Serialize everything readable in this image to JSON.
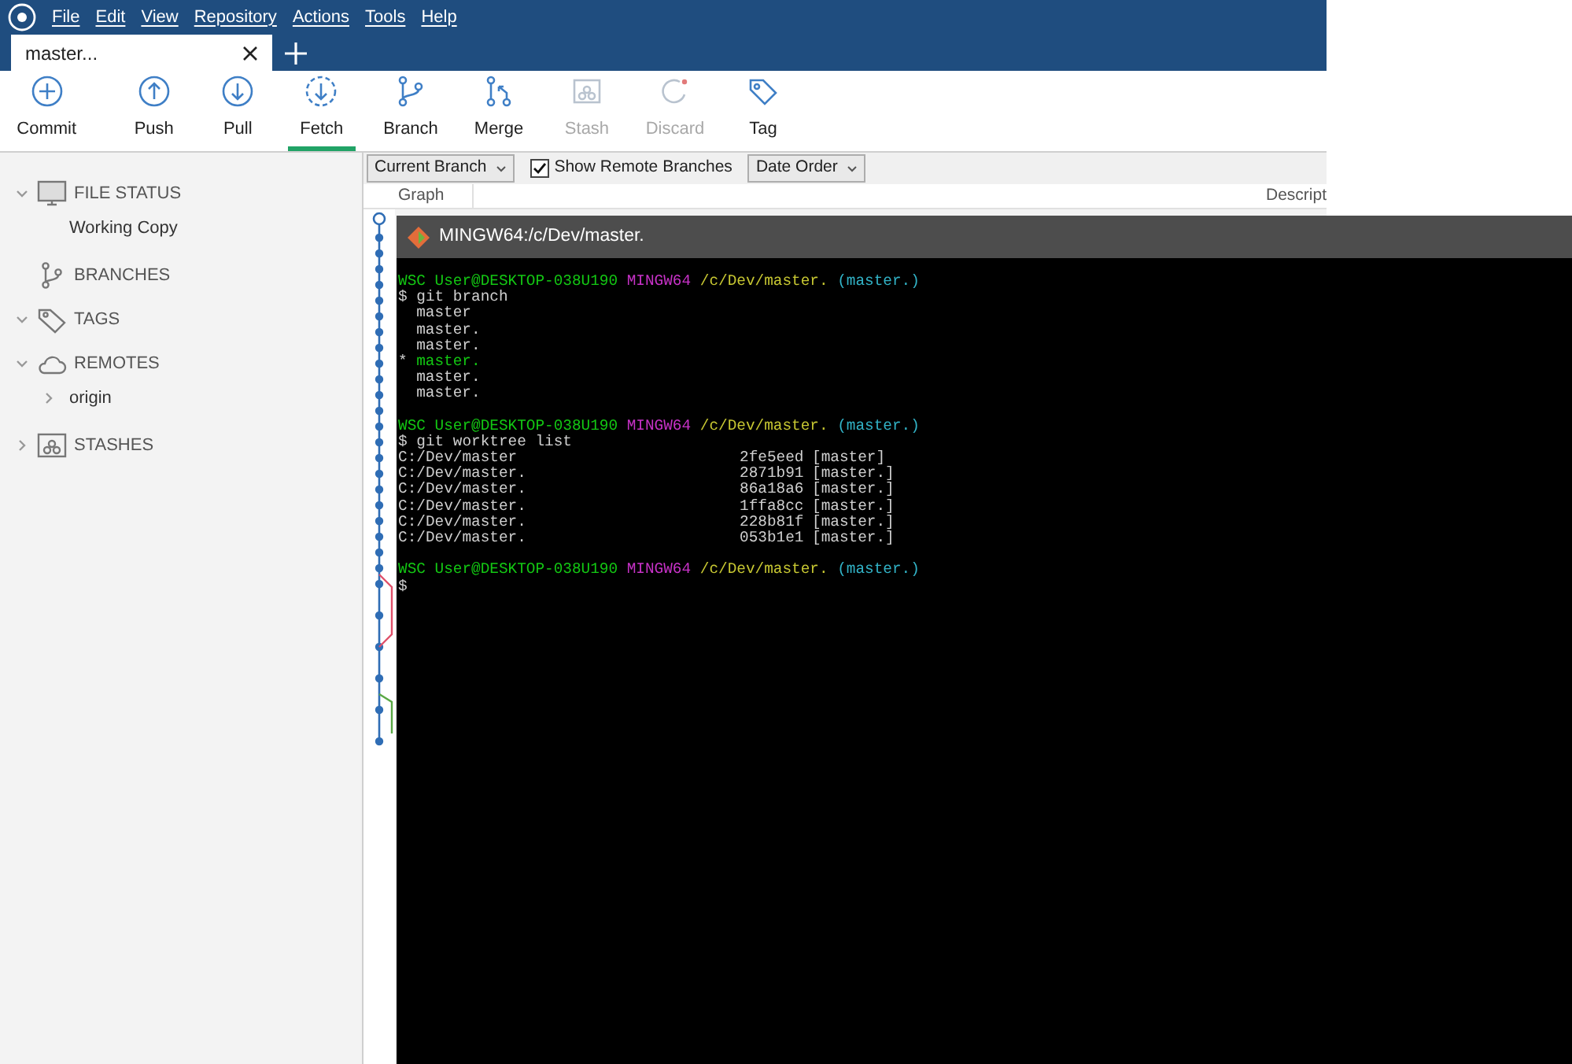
{
  "menu": [
    "File",
    "Edit",
    "View",
    "Repository",
    "Actions",
    "Tools",
    "Help"
  ],
  "tabs": [
    {
      "label": "master.",
      "ellipsis": "..",
      "selected": true
    }
  ],
  "toolbar": [
    {
      "label": "Commit",
      "kind": "plus",
      "selected": false,
      "disabled": false
    },
    {
      "label": "Push",
      "kind": "up",
      "selected": false,
      "disabled": false
    },
    {
      "label": "Pull",
      "kind": "down",
      "selected": false,
      "disabled": false
    },
    {
      "label": "Fetch",
      "kind": "fetch",
      "selected": true,
      "disabled": false
    },
    {
      "label": "Branch",
      "kind": "branch",
      "selected": false,
      "disabled": false
    },
    {
      "label": "Merge",
      "kind": "merge",
      "selected": false,
      "disabled": false
    },
    {
      "label": "Stash",
      "kind": "stash",
      "selected": false,
      "disabled": true
    },
    {
      "label": "Discard",
      "kind": "discard",
      "selected": false,
      "disabled": true
    },
    {
      "label": "Tag",
      "kind": "tag",
      "selected": false,
      "disabled": false
    }
  ],
  "sidebar": [
    {
      "label": "FILE STATUS",
      "kind": "monitor",
      "expanded": true,
      "children": [
        {
          "label": "Working Copy"
        }
      ]
    },
    {
      "label": "BRANCHES",
      "kind": "branch"
    },
    {
      "label": "TAGS",
      "kind": "tag",
      "expanded": true
    },
    {
      "label": "REMOTES",
      "kind": "cloud",
      "expanded": true,
      "children": [
        {
          "label": "origin",
          "expanded": false
        }
      ]
    },
    {
      "label": "STASHES",
      "kind": "stash",
      "expanded": false
    }
  ],
  "filters": {
    "branch_dropdown": "Current Branch",
    "remote_checkbox": {
      "label": "Show Remote Branches",
      "checked": true
    },
    "order_dropdown": "Date Order"
  },
  "columns": [
    "Graph",
    "Descript"
  ],
  "terminal": {
    "title": "MINGW64:/c/Dev/master.",
    "lines": [
      {
        "kind": "prompt",
        "user": "WSC User@DESKTOP-038U190",
        "system": "MINGW64",
        "path": "/c/Dev/master.",
        "branch": "(master.",
        "close": ")"
      },
      {
        "kind": "command",
        "text": "$ git branch"
      },
      {
        "kind": "branch",
        "name": "master",
        "current": false
      },
      {
        "kind": "branch",
        "name": "master.",
        "current": false
      },
      {
        "kind": "branch",
        "name": "master.",
        "current": false
      },
      {
        "kind": "branch",
        "marker": "*",
        "name": "master.",
        "current": true
      },
      {
        "kind": "branch",
        "name": "master.",
        "current": false
      },
      {
        "kind": "branch",
        "name": "master.",
        "current": false
      },
      {
        "kind": "blank"
      },
      {
        "kind": "prompt",
        "user": "WSC User@DESKTOP-038U190",
        "system": "MINGW64",
        "path": "/c/Dev/master.",
        "branch": "(master.",
        "close": ")"
      },
      {
        "kind": "command",
        "text": "$ git worktree list"
      },
      {
        "kind": "worktree",
        "path": "C:/Dev/master",
        "hash": "2fe5eed",
        "branch": "[master]"
      },
      {
        "kind": "worktree",
        "path": "C:/Dev/master.",
        "hash": "2871b91",
        "branch": "[master.",
        "close": "]"
      },
      {
        "kind": "worktree",
        "path": "C:/Dev/master.",
        "hash": "86a18a6",
        "branch": "[master.",
        "close": "]"
      },
      {
        "kind": "worktree",
        "path": "C:/Dev/master.",
        "hash": "1ffa8cc",
        "branch": "[master.",
        "close": "]"
      },
      {
        "kind": "worktree",
        "path": "C:/Dev/master.",
        "hash": "228b81f",
        "branch": "[master.",
        "close": "]"
      },
      {
        "kind": "worktree",
        "path": "C:/Dev/master.",
        "hash": "053b1e1",
        "branch": "[master.",
        "close": "]"
      },
      {
        "kind": "blank"
      },
      {
        "kind": "prompt",
        "user": "WSC User@DESKTOP-038U190",
        "system": "MINGW64",
        "path": "/c/Dev/master.",
        "branch": "(master.",
        "close": ")"
      },
      {
        "kind": "command",
        "text": "$"
      }
    ]
  }
}
